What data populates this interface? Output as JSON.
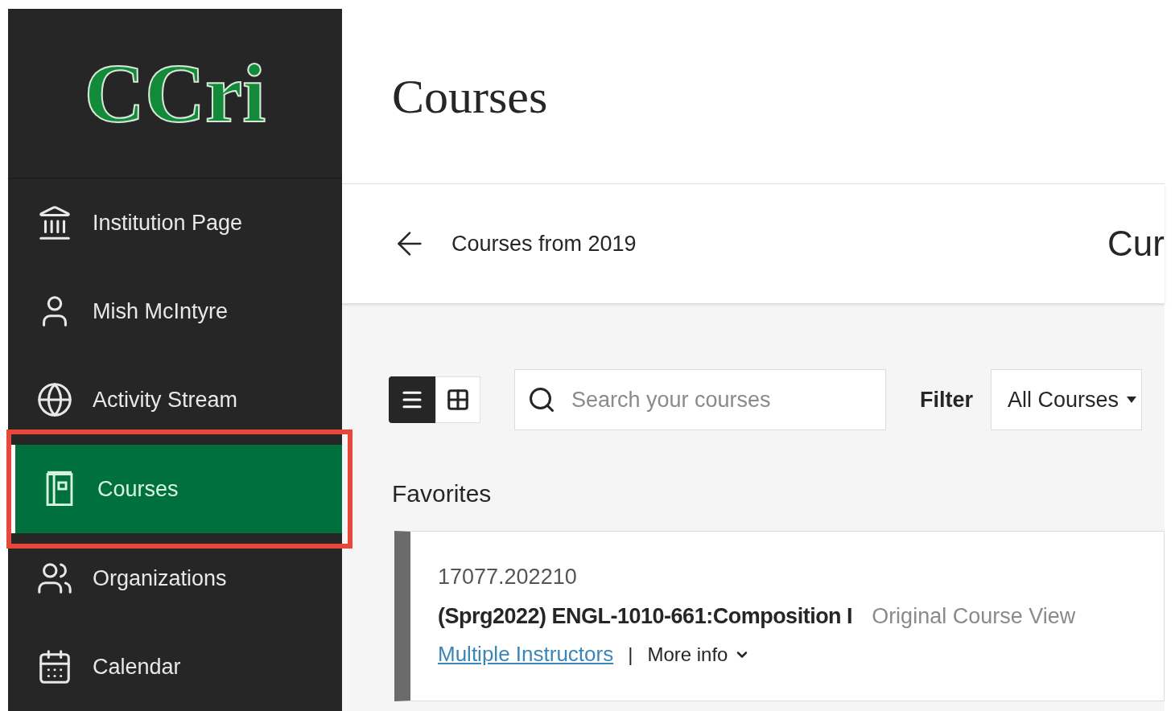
{
  "logo": {
    "text": "CCri"
  },
  "nav": [
    {
      "label": "Institution Page",
      "kind": "institution",
      "selected": false,
      "annotated": false
    },
    {
      "label": "Mish McIntyre",
      "kind": "person",
      "selected": false,
      "annotated": false
    },
    {
      "label": "Activity Stream",
      "kind": "globe",
      "selected": false,
      "annotated": false
    },
    {
      "label": "Courses",
      "kind": "courses",
      "selected": true,
      "annotated": true
    },
    {
      "label": "Organizations",
      "kind": "group",
      "selected": false,
      "annotated": false
    },
    {
      "label": "Calendar",
      "kind": "calendar",
      "selected": false,
      "annotated": false
    }
  ],
  "page_title": "Courses",
  "subheader": {
    "back_label": "Courses from 2019",
    "next_label": "Cur"
  },
  "view_toggle": [
    {
      "kind": "list",
      "selected": true
    },
    {
      "kind": "grid",
      "selected": false
    }
  ],
  "search": {
    "placeholder": "Search your courses"
  },
  "filter": {
    "label": "Filter",
    "value": "All Courses"
  },
  "section_title": "Favorites",
  "courses": [
    {
      "id": "17077.202210",
      "name": "(Sprg2022) ENGL-1010-661:Composition I",
      "view": "Original Course View",
      "instructors": "Multiple Instructors",
      "separator": "|",
      "more": "More info"
    }
  ]
}
